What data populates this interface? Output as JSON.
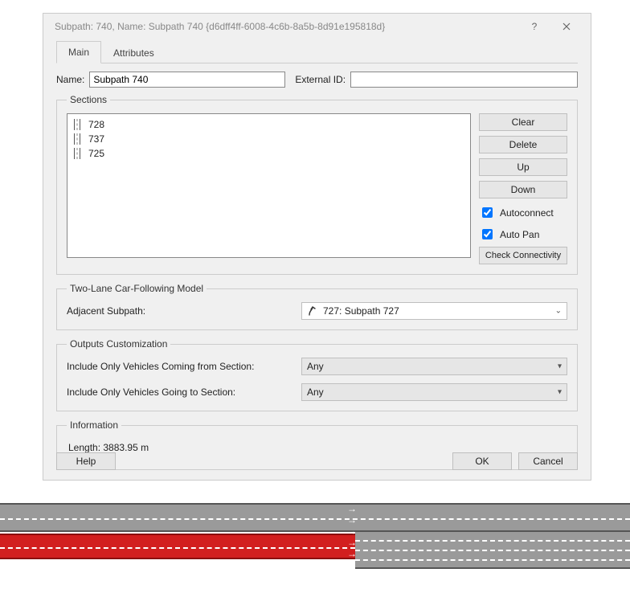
{
  "window": {
    "title": "Subpath: 740, Name: Subpath 740  {d6dff4ff-6008-4c6b-8a5b-8d91e195818d}"
  },
  "tabs": {
    "main": "Main",
    "attributes": "Attributes"
  },
  "form": {
    "name_label": "Name:",
    "name_value": "Subpath 740",
    "extid_label": "External ID:",
    "extid_value": ""
  },
  "sections": {
    "legend": "Sections",
    "items": [
      "728",
      "737",
      "725"
    ],
    "buttons": {
      "clear": "Clear",
      "delete": "Delete",
      "up": "Up",
      "down": "Down",
      "check": "Check Connectivity"
    },
    "checks": {
      "autoconnect": "Autoconnect",
      "autopan": "Auto Pan"
    },
    "autoconnect_checked": true,
    "autopan_checked": true
  },
  "twolane": {
    "legend": "Two-Lane Car-Following Model",
    "label": "Adjacent Subpath:",
    "value": "727: Subpath 727"
  },
  "outputs": {
    "legend": "Outputs Customization",
    "from_label": "Include Only Vehicles Coming from Section:",
    "from_value": "Any",
    "to_label": "Include Only Vehicles Going to Section:",
    "to_value": "Any"
  },
  "info": {
    "legend": "Information",
    "length": "Length: 3883.95 m"
  },
  "footer": {
    "help": "Help",
    "ok": "OK",
    "cancel": "Cancel"
  }
}
